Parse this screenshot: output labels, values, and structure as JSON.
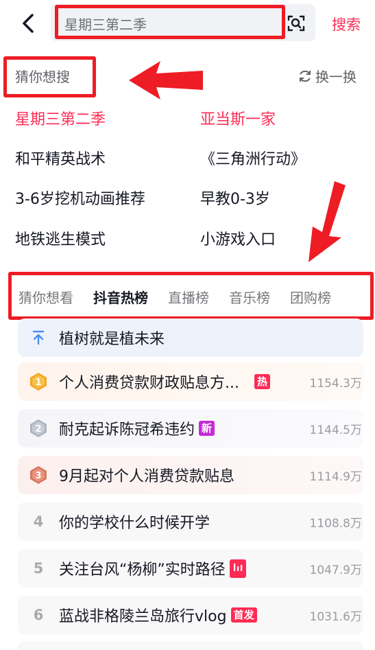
{
  "search": {
    "query": "星期三第二季",
    "button_label": "搜索"
  },
  "guess": {
    "title": "猜你想搜",
    "refresh_label": "换一换",
    "items": [
      {
        "text": "星期三第二季",
        "hot": true
      },
      {
        "text": "亚当斯一家",
        "hot": true
      },
      {
        "text": "和平精英战术",
        "hot": false
      },
      {
        "text": "《三角洲行动》",
        "hot": false
      },
      {
        "text": "3-6岁挖机动画推荐",
        "hot": false
      },
      {
        "text": "早教0-3岁",
        "hot": false
      },
      {
        "text": "地铁逃生模式",
        "hot": false
      },
      {
        "text": "小游戏入口",
        "hot": false
      }
    ]
  },
  "tabs": [
    "猜你想看",
    "抖音热榜",
    "直播榜",
    "音乐榜",
    "团购榜"
  ],
  "active_tab": "抖音热榜",
  "list": {
    "pinned": "植树就是植未来",
    "items": [
      {
        "rank": "1",
        "title": "个人消费贷款财政贴息方...",
        "badge": "热",
        "heat": "1154.3万"
      },
      {
        "rank": "2",
        "title": "耐克起诉陈冠希违约",
        "badge": "新",
        "heat": "1144.5万"
      },
      {
        "rank": "3",
        "title": "9月起对个人消费贷款贴息",
        "badge": "",
        "heat": "1114.9万"
      },
      {
        "rank": "4",
        "title": "你的学校什么时候开学",
        "badge": "",
        "heat": "1108.8万"
      },
      {
        "rank": "5",
        "title": "关注台风“杨柳”实时路径",
        "badge": "chart-icon",
        "heat": "1047.9万"
      },
      {
        "rank": "6",
        "title": "蓝战非格陵兰岛旅行vlog",
        "badge": "首发",
        "heat": "1031.6万"
      }
    ]
  },
  "colors": {
    "accent": "#fe2c55",
    "annotation": "#ee1c25",
    "badge_hot": "#fe2c55",
    "badge_new": "#c72bd6",
    "badge_first": "#fe2c55",
    "pinned_arrow": "#4a8cf7"
  }
}
